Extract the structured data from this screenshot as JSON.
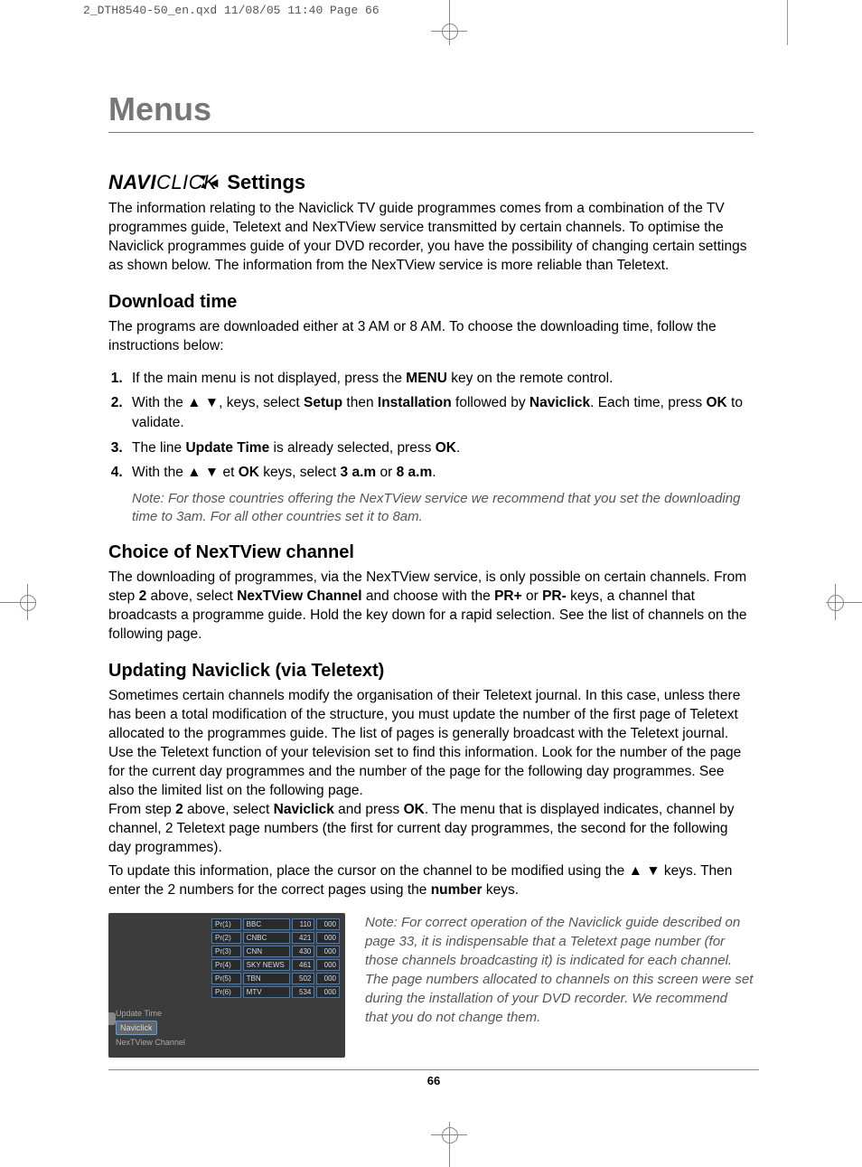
{
  "printer_header": "2_DTH8540-50_en.qxd  11/08/05  11:40  Page 66",
  "title": "Menus",
  "logo": {
    "bold": "NAVI",
    "light": "CLICK"
  },
  "settings_heading": "Settings",
  "intro": "The information relating to the Naviclick TV guide programmes comes from a combination of the TV programmes guide, Teletext and NexTView service transmitted by certain channels. To optimise the Naviclick programmes guide of your DVD recorder, you have the possibility of changing certain settings as shown below. The information from the NexTView service is more reliable than Teletext.",
  "download_time_heading": "Download time",
  "download_time_intro": "The programs are downloaded either at 3 AM or 8 AM. To choose the downloading time, follow the instructions below:",
  "steps": {
    "s1_a": "If the main menu is not displayed, press the ",
    "s1_menu": "MENU",
    "s1_b": " key on the remote control.",
    "s2_a": "With the ▲ ▼, keys, select ",
    "s2_setup": "Setup",
    "s2_b": " then ",
    "s2_install": "Installation",
    "s2_c": " followed by ",
    "s2_navi": "Naviclick",
    "s2_d": ". Each time, press ",
    "s2_ok": "OK",
    "s2_e": " to validate.",
    "s3_a": "The line ",
    "s3_update": "Update Time",
    "s3_b": " is already selected, press ",
    "s3_ok": "OK",
    "s3_c": ".",
    "s4_a": "With the ▲ ▼ et ",
    "s4_ok": "OK",
    "s4_b": " keys, select ",
    "s4_3am": "3 a.m",
    "s4_c": " or ",
    "s4_8am": "8 a.m",
    "s4_d": "."
  },
  "note1": "Note: For those countries offering the NexTView service we recommend that you set the downloading time to 3am. For all other countries set it to 8am.",
  "choice_heading": "Choice of NexTView channel",
  "choice_a": "The downloading of programmes, via the NexTView service, is only possible on certain channels. From step ",
  "choice_step2": "2",
  "choice_b": " above, select ",
  "choice_nextv": "NexTView Channel",
  "choice_c": " and choose with the ",
  "choice_prplus": "PR+",
  "choice_d": " or ",
  "choice_prminus": "PR-",
  "choice_e": " keys, a channel that broadcasts a programme guide. Hold the key down for a rapid selection. See the list of channels on the following page.",
  "updating_heading": "Updating Naviclick (via Teletext)",
  "updating_p1_a": "Sometimes certain channels modify the organisation of their Teletext journal. In this case, unless there has been a total modification of the structure, you must update the number of the first page of Teletext allocated to the programmes guide. The list of pages is generally broadcast with the Teletext journal. Use the Teletext function of your television set to find this information. Look for the number of the page for the current day programmes and the number of the page for the following day programmes. See also the limited list on the following page.",
  "updating_p1_b1": "From step ",
  "updating_p1_b2": "2",
  "updating_p1_b3": " above, select ",
  "updating_p1_b4": "Naviclick",
  "updating_p1_b5": " and press ",
  "updating_p1_b6": "OK",
  "updating_p1_b7": ". The menu that is displayed indicates, channel by channel, 2 Teletext page numbers (the first for current day programmes, the second for the following day programmes).",
  "updating_p2_a": "To update this information, place the cursor on the channel to be modified using the ▲ ▼ keys. Then enter the 2 numbers for the correct pages using the ",
  "updating_p2_number": "number",
  "updating_p2_b": " keys.",
  "fig_side": {
    "update": "Update Time",
    "navi": "Naviclick",
    "nextv": "NexTView Channel"
  },
  "fig_rows": [
    {
      "pr": "Pr(1)",
      "ch": "BBC",
      "a": "110",
      "b": "000"
    },
    {
      "pr": "Pr(2)",
      "ch": "CNBC",
      "a": "421",
      "b": "000"
    },
    {
      "pr": "Pr(3)",
      "ch": "CNN",
      "a": "430",
      "b": "000"
    },
    {
      "pr": "Pr(4)",
      "ch": "SKY NEWS",
      "a": "461",
      "b": "000"
    },
    {
      "pr": "Pr(5)",
      "ch": "TBN",
      "a": "502",
      "b": "000"
    },
    {
      "pr": "Pr(6)",
      "ch": "MTV",
      "a": "534",
      "b": "000"
    }
  ],
  "fig_caption": "Note: For correct operation of the Naviclick guide described on page 33, it is indispensable that a Teletext page number (for those channels broadcasting it) is indicated for each channel. The page numbers allocated to channels on this screen were set during the installation of your DVD recorder. We recommend that you do not change them.",
  "page_number": "66"
}
